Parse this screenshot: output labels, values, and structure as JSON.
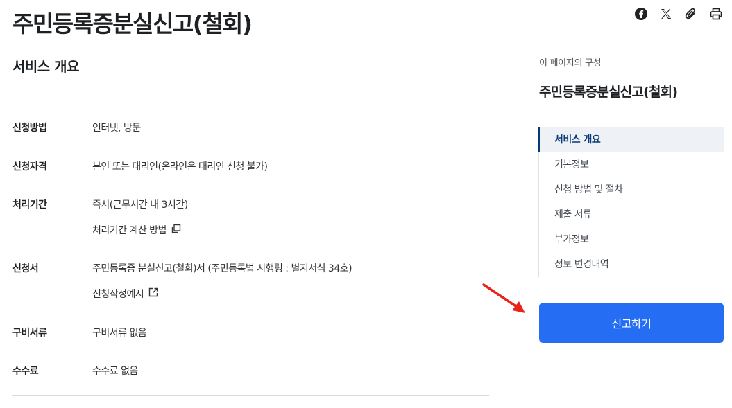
{
  "page": {
    "title": "주민등록증분실신고(철회)"
  },
  "share": {
    "icons": [
      "facebook-icon",
      "x-twitter-icon",
      "link-clip-icon",
      "print-icon"
    ]
  },
  "main": {
    "section_title": "서비스 개요",
    "rows": [
      {
        "label": "신청방법",
        "value": "인터넷, 방문"
      },
      {
        "label": "신청자격",
        "value": "본인 또는 대리인(온라인은 대리인 신청 불가)"
      },
      {
        "label": "처리기간",
        "value": "즉시(근무시간 내 3시간)",
        "link": "처리기간 계산 방법"
      },
      {
        "label": "신청서",
        "value": "주민등록증 분실신고(철회)서 (주민등록법 시행령 : 별지서식 34호)",
        "link": "신청작성예시"
      },
      {
        "label": "구비서류",
        "value": "구비서류 없음"
      },
      {
        "label": "수수료",
        "value": "수수료 없음"
      }
    ]
  },
  "toc": {
    "caption": "이 페이지의 구성",
    "heading": "주민등록증분실신고(철회)",
    "items": [
      {
        "label": "서비스 개요",
        "active": true
      },
      {
        "label": "기본정보"
      },
      {
        "label": "신청 방법 및 절차"
      },
      {
        "label": "제출 서류"
      },
      {
        "label": "부가정보"
      },
      {
        "label": "정보 변경내역"
      }
    ]
  },
  "action": {
    "report_label": "신고하기"
  },
  "colors": {
    "primary": "#256ef4",
    "toc_active": "#063a74",
    "annotation": "#e8231b"
  }
}
